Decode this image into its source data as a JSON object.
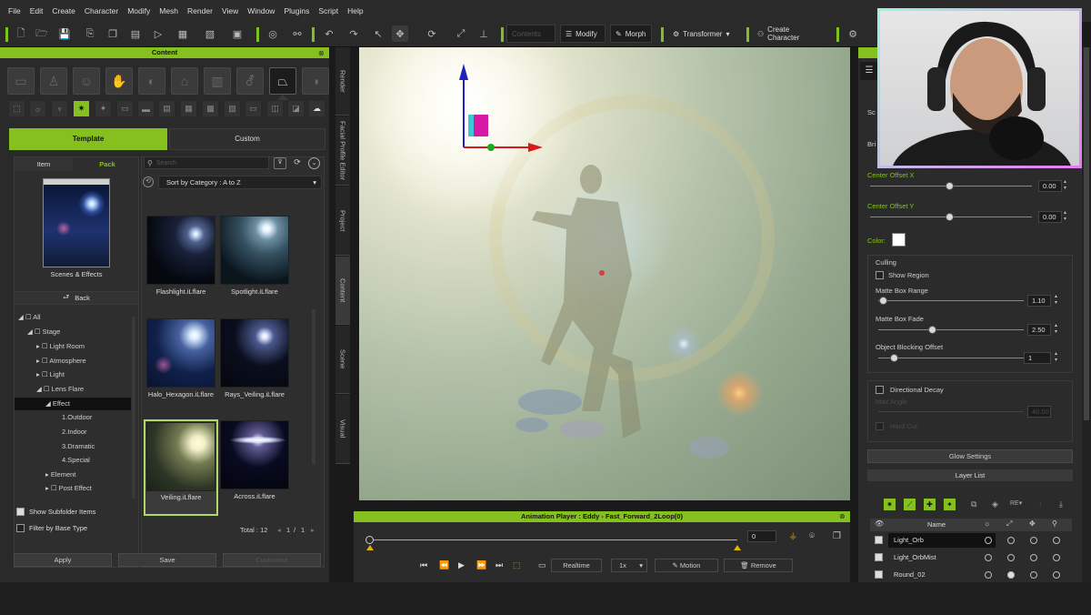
{
  "menu": [
    "File",
    "Edit",
    "Create",
    "Character",
    "Modify",
    "Mesh",
    "Render",
    "View",
    "Window",
    "Plugins",
    "Script",
    "Help"
  ],
  "toolbar": {
    "contents_label": "Contents",
    "modify_label": "Modify",
    "morph_label": "Morph",
    "transformer_label": "Transformer",
    "create_character_label": "Create Character"
  },
  "content": {
    "title": "Content",
    "tabs": {
      "template": "Template",
      "custom": "Custom"
    },
    "subtabs": {
      "item": "Item",
      "pack": "Pack"
    },
    "search_placeholder": "Search",
    "sort_label": "Sort by Category : A to Z",
    "pack_label": "Scenes & Effects",
    "back_label": "Back",
    "tree": [
      "All",
      "Stage",
      "Light Room",
      "Atmosphere",
      "Light",
      "Lens Flare",
      "Effect",
      "1.Outdoor",
      "2.Indoor",
      "3.Dramatic",
      "4.Special",
      "Element",
      "Post Effect"
    ],
    "items": [
      "Flashlight.iLflare",
      "Spotlight.iLflare",
      "Halo_Hexagon.iLflare",
      "Rays_Veiling.iLflare",
      "Veiling.iLflare",
      "Across.iLflare"
    ],
    "show_subfolder": "Show Subfolder Items",
    "filter_base": "Filter by Base Type",
    "total": "Total : 12",
    "page": "1",
    "page_sep": "/",
    "page_total": "1",
    "apply": "Apply",
    "save": "Save",
    "customize": "Customize"
  },
  "side_tabs": [
    "Render",
    "Facial Profile Editor",
    "Project",
    "Content",
    "Scene",
    "Visual"
  ],
  "player": {
    "title": "Animation Player : Eddy - Fast_Forward_2Loop(0)",
    "frame": "0",
    "realtime": "Realtime",
    "speed": "1x",
    "motion": "Motion",
    "remove": "Remove"
  },
  "properties": {
    "sc_label": "Sc",
    "bri_label": "Bri",
    "center_offset_x_label": "Center Offset X",
    "center_offset_x": "0.00",
    "center_offset_y_label": "Center Offset Y",
    "center_offset_y": "0.00",
    "color_label": "Color:",
    "culling_label": "Culling",
    "show_region": "Show Region",
    "matte_box_range_label": "Matte Box Range",
    "matte_box_range": "1.10",
    "matte_box_fade_label": "Matte Box Fade",
    "matte_box_fade": "2.50",
    "object_blocking_label": "Object Blocking Offset",
    "object_blocking": "1",
    "directional_decay": "Directional Decay",
    "max_angle_label": "Max Angle",
    "max_angle": "40.00",
    "hard_cut_label": "Hard Cut",
    "glow_settings": "Glow Settings",
    "layer_list": "Layer List",
    "name_header": "Name",
    "ref_label": "RE",
    "layers": [
      {
        "name": "Light_Orb"
      },
      {
        "name": "Light_OrbMist"
      },
      {
        "name": "Round_02"
      }
    ]
  },
  "colors": {
    "accent": "#86c01e",
    "color_swatch": "#ffffff"
  },
  "icons": [
    "gizmo-move-icon",
    "webcam-feed"
  ]
}
